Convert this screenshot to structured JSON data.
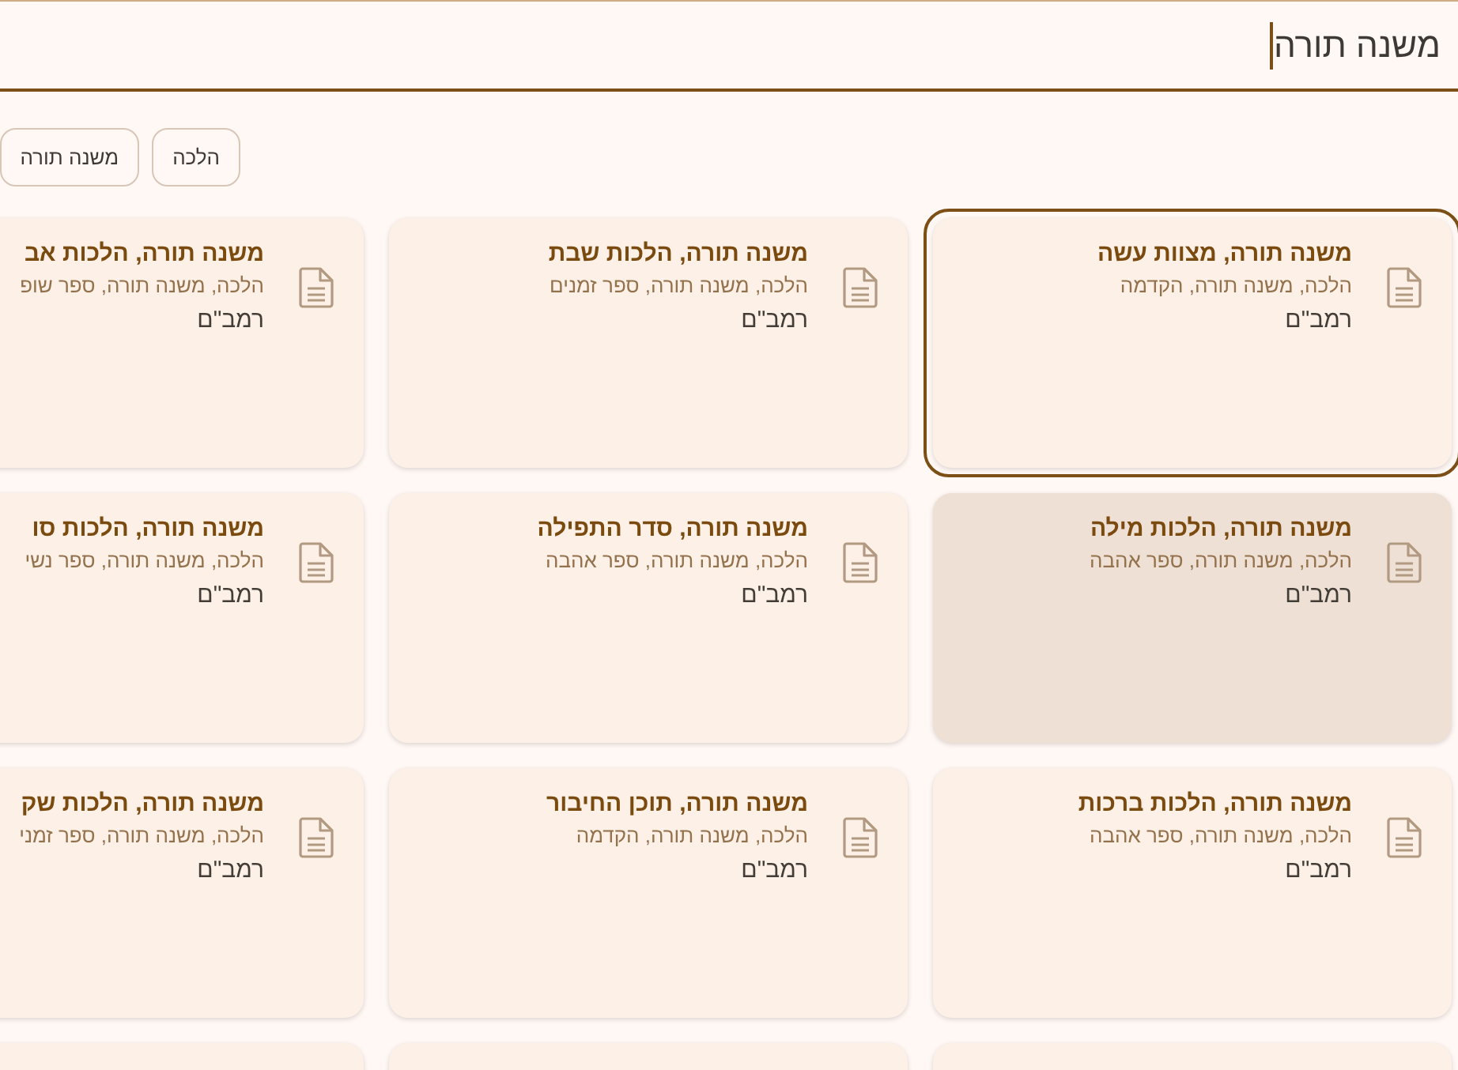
{
  "search": {
    "value": "משנה תורה",
    "focused": true
  },
  "chips": [
    {
      "label": "הלכה"
    },
    {
      "label": "משנה תורה"
    }
  ],
  "cards": [
    {
      "kind": "result",
      "title": "משנה תורה, מצוות עשה",
      "categories": "הלכה, משנה תורה, הקדמה",
      "author": "רמב\"ם",
      "focused": true,
      "hovered": false
    },
    {
      "kind": "result",
      "title": "משנה תורה, הלכות שבת",
      "categories": "הלכה, משנה תורה, ספר זמנים",
      "author": "רמב\"ם",
      "focused": false,
      "hovered": false
    },
    {
      "kind": "result",
      "title": "משנה תורה, הלכות אב",
      "categories": "הלכה, משנה תורה, ספר שופ",
      "author": "רמב\"ם",
      "focused": false,
      "hovered": false
    },
    {
      "kind": "result",
      "title": "משנה תורה, הלכות מילה",
      "categories": "הלכה, משנה תורה, ספר אהבה",
      "author": "רמב\"ם",
      "focused": false,
      "hovered": true
    },
    {
      "kind": "result",
      "title": "משנה תורה, סדר התפילה",
      "categories": "הלכה, משנה תורה, ספר אהבה",
      "author": "רמב\"ם",
      "focused": false,
      "hovered": false
    },
    {
      "kind": "result",
      "title": "משנה תורה, הלכות סו",
      "categories": "הלכה, משנה תורה, ספר נשי",
      "author": "רמב\"ם",
      "focused": false,
      "hovered": false
    },
    {
      "kind": "result",
      "title": "משנה תורה, הלכות ברכות",
      "categories": "הלכה, משנה תורה, ספר אהבה",
      "author": "רמב\"ם",
      "focused": false,
      "hovered": false
    },
    {
      "kind": "result",
      "title": "משנה תורה, תוכן החיבור",
      "categories": "הלכה, משנה תורה, הקדמה",
      "author": "רמב\"ם",
      "focused": false,
      "hovered": false
    },
    {
      "kind": "result",
      "title": "משנה תורה, הלכות שק",
      "categories": "הלכה, משנה תורה, ספר זמני",
      "author": "רמב\"ם",
      "focused": false,
      "hovered": false
    },
    {
      "kind": "cut_off"
    },
    {
      "kind": "cut_off"
    },
    {
      "kind": "cut_off"
    }
  ]
}
